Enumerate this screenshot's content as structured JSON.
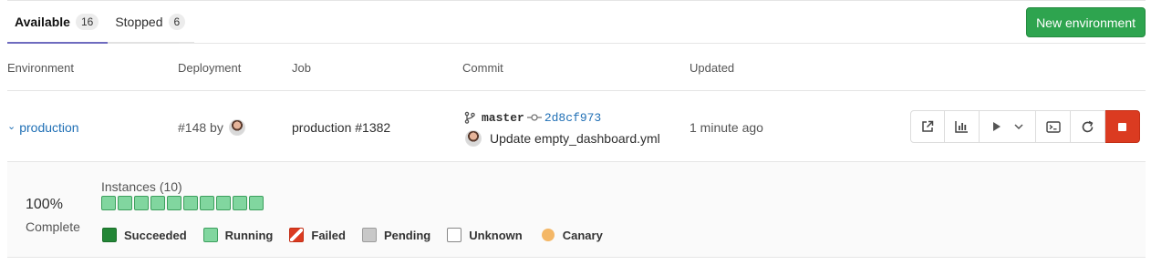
{
  "tabs": [
    {
      "label": "Available",
      "count": "16"
    },
    {
      "label": "Stopped",
      "count": "6"
    }
  ],
  "new_environment_label": "New environment",
  "columns": {
    "environment": "Environment",
    "deployment": "Deployment",
    "job": "Job",
    "commit": "Commit",
    "updated": "Updated"
  },
  "row": {
    "environment": "production",
    "deployment": "#148 by",
    "job": "production #1382",
    "branch": "master",
    "sha": "2d8cf973",
    "commit_message": "Update empty_dashboard.yml",
    "updated": "1 minute ago"
  },
  "actions": [
    "external-link-icon",
    "monitoring-icon",
    "play-icon",
    "terminal-icon",
    "retry-icon",
    "stop-icon"
  ],
  "details": {
    "percent": "100%",
    "percent_label": "Complete",
    "instances_title": "Instances (10)",
    "instance_count": 10,
    "instance_status": "running"
  },
  "legend": [
    {
      "label": "Succeeded",
      "status": "succeeded"
    },
    {
      "label": "Running",
      "status": "running"
    },
    {
      "label": "Failed",
      "status": "failed"
    },
    {
      "label": "Pending",
      "status": "pending"
    },
    {
      "label": "Unknown",
      "status": "unknown"
    },
    {
      "label": "Canary",
      "status": "canary"
    }
  ],
  "colors": {
    "accent_tab": "#6e6bbf",
    "primary_button": "#2ea44f",
    "link": "#1f6fb5",
    "stop_button": "#db3b21",
    "running": "#81d69f",
    "succeeded": "#238636",
    "canary": "#f4b766"
  }
}
